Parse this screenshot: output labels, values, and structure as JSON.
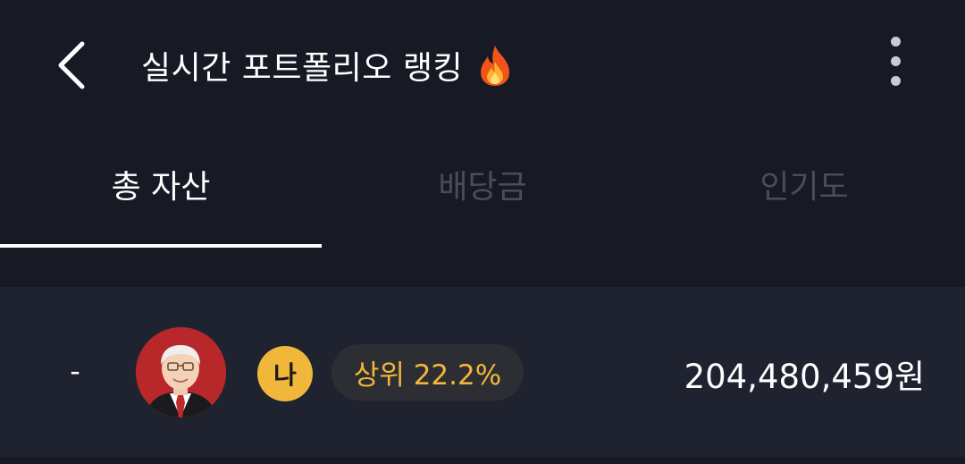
{
  "header": {
    "title": "실시간 포트폴리오 랭킹",
    "back_icon": "chevron-left-icon",
    "title_icon": "fire-icon",
    "more_icon": "more-vertical-icon"
  },
  "tabs": [
    {
      "label": "총 자산",
      "active": true
    },
    {
      "label": "배당금",
      "active": false
    },
    {
      "label": "인기도",
      "active": false
    }
  ],
  "ranking_row": {
    "rank": "-",
    "avatar": "investor-portrait-avatar",
    "me_badge": "나",
    "percentile": "상위 22.2%",
    "amount": "204,480,459원"
  },
  "colors": {
    "background": "#171a25",
    "row_background": "#1f2330",
    "accent": "#f0b73a",
    "inactive_tab": "#4a4d58"
  }
}
